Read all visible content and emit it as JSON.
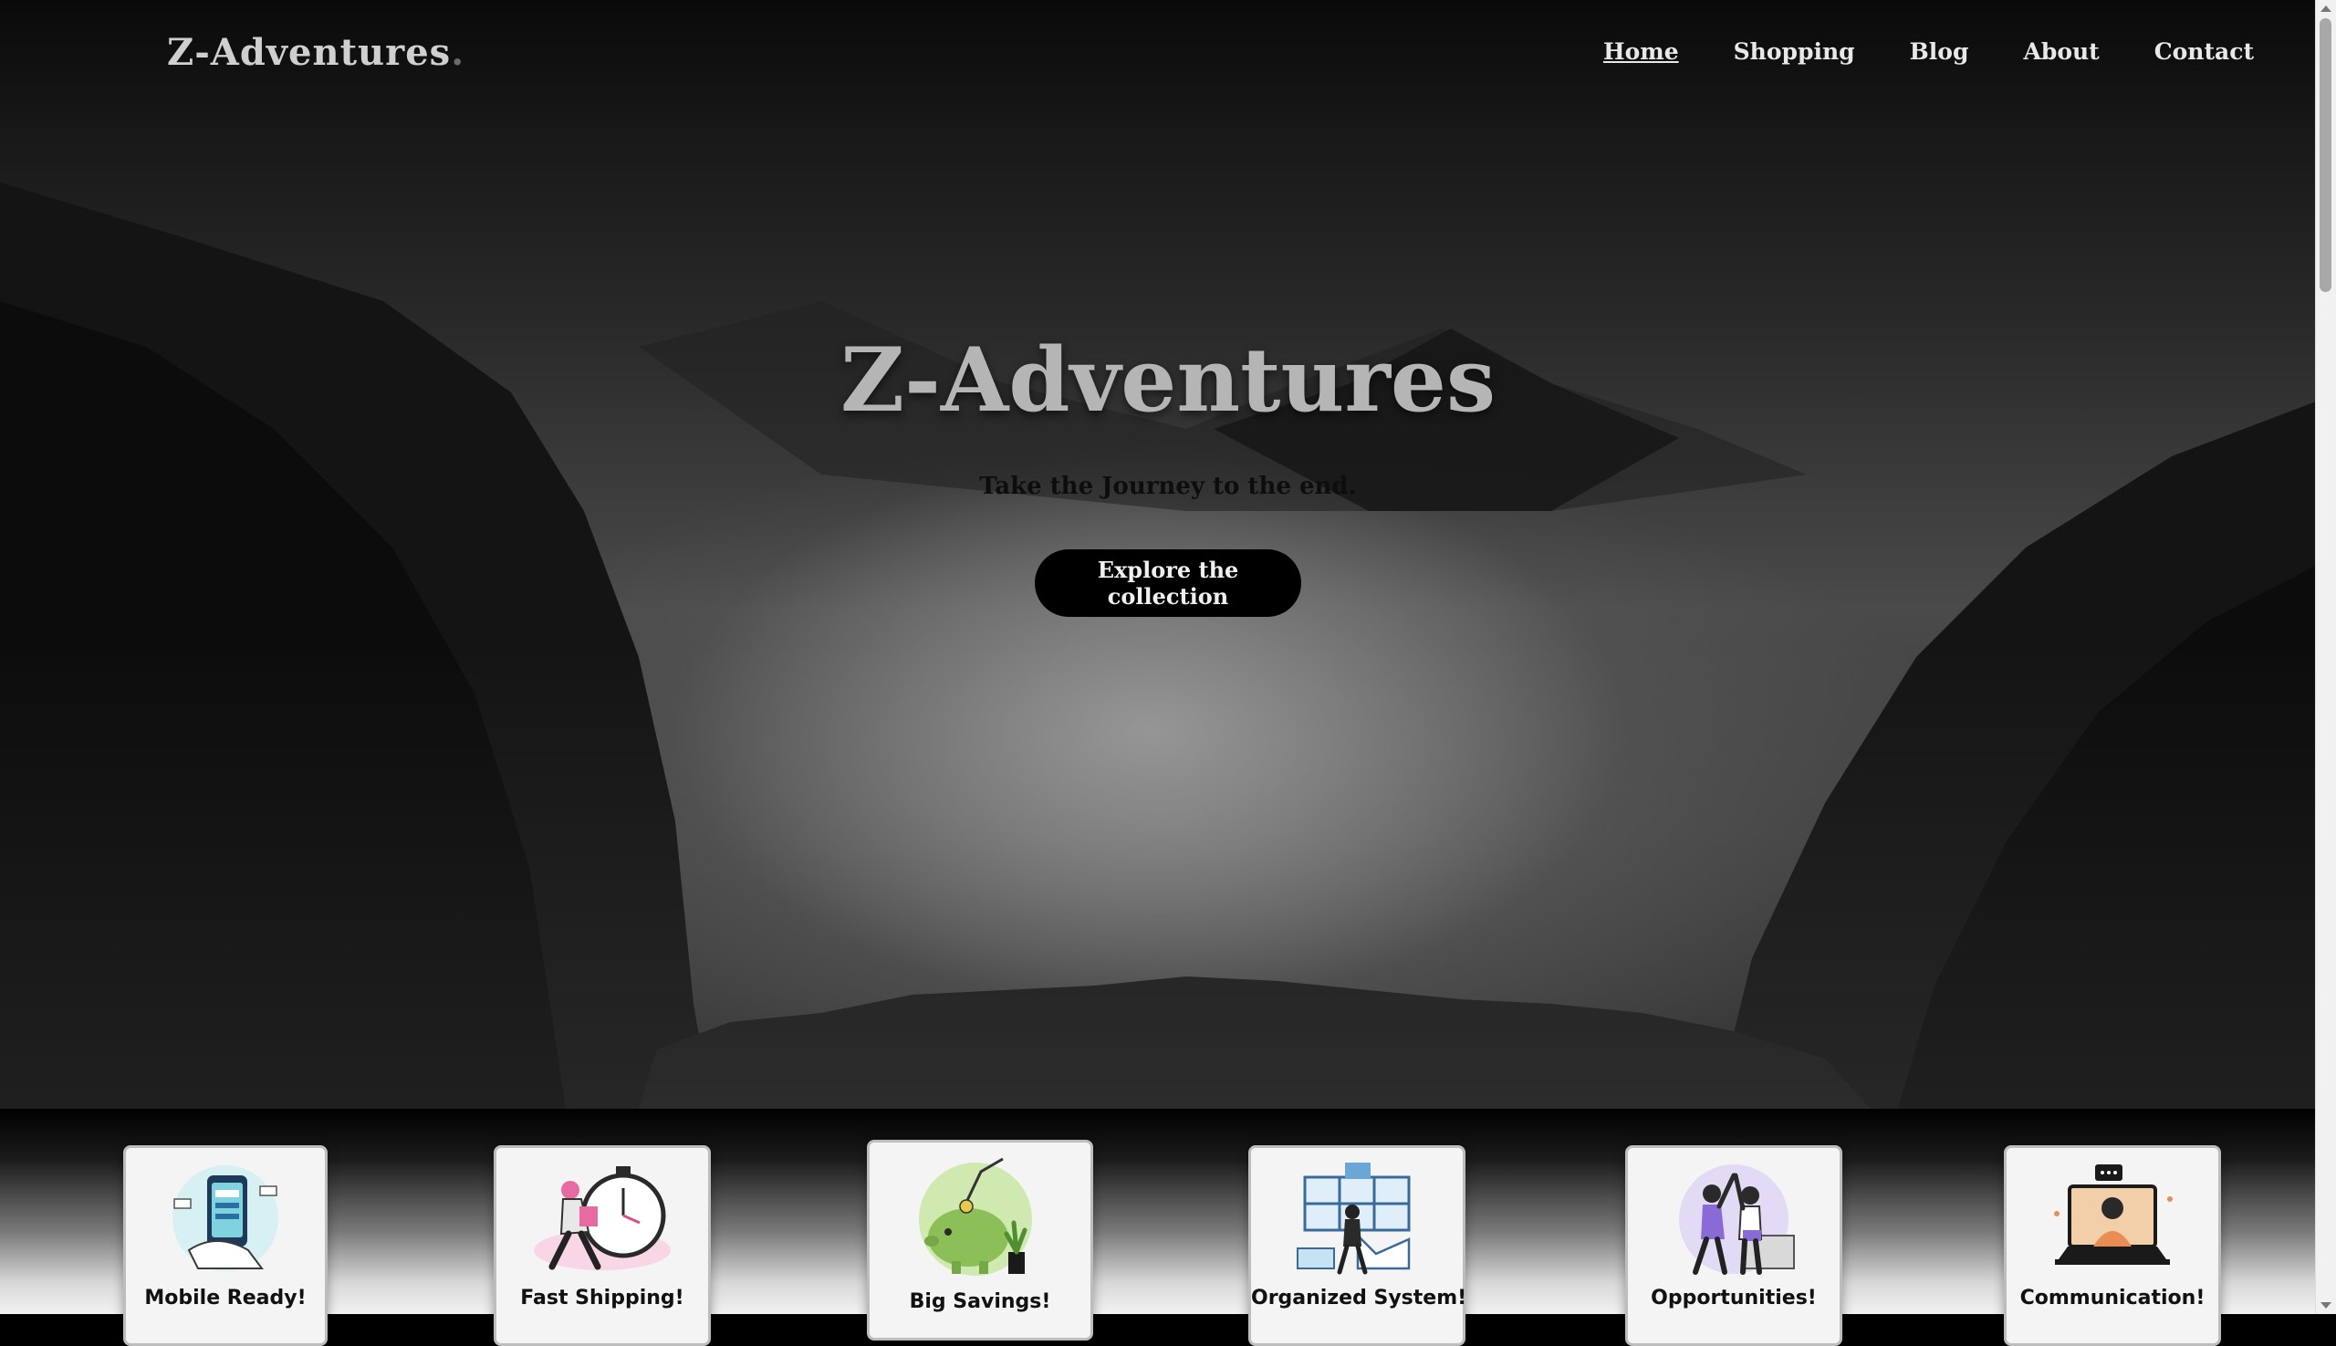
{
  "nav": {
    "logo_text": "Z-Adventures",
    "logo_dot": ".",
    "links": [
      "Home",
      "Shopping",
      "Blog",
      "About",
      "Contact"
    ]
  },
  "hero": {
    "title": "Z-Adventures",
    "subtitle": "Take the Journey to the end.",
    "cta_label": "Explore the collection"
  },
  "features": [
    {
      "label": "Mobile Ready!",
      "icon": "phone-payment-icon"
    },
    {
      "label": "Fast Shipping!",
      "icon": "stopwatch-runner-icon"
    },
    {
      "label": "Big Savings!",
      "icon": "piggy-bank-icon"
    },
    {
      "label": "Organized System!",
      "icon": "office-window-icon"
    },
    {
      "label": "Opportunities!",
      "icon": "high-five-icon"
    },
    {
      "label": "Communication!",
      "icon": "laptop-chat-icon"
    }
  ],
  "colors": {
    "accent": "#000000",
    "nav_text": "#e8e8e8",
    "title_text": "#b5b5b5"
  }
}
